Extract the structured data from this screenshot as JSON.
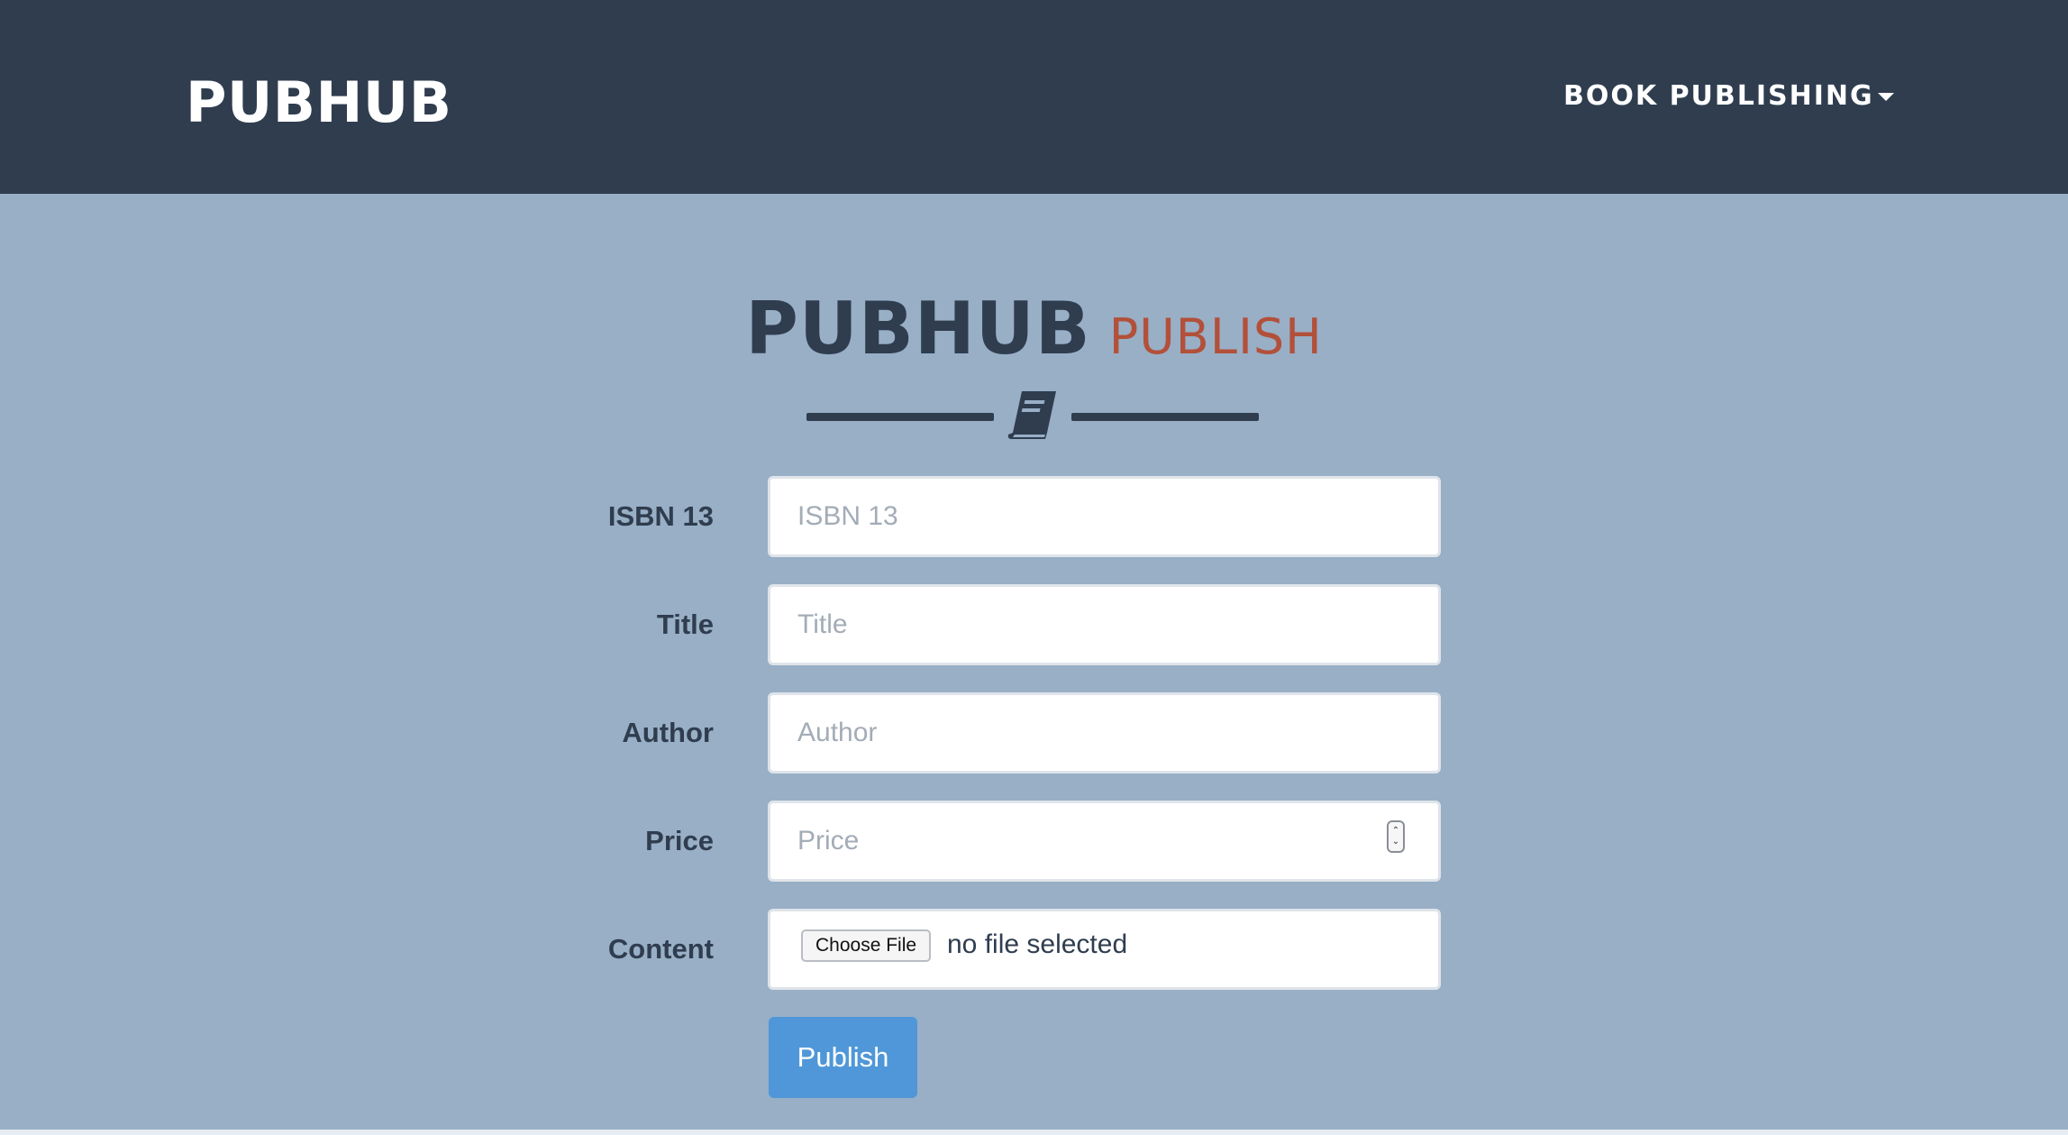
{
  "navbar": {
    "brand": "PUBHUB",
    "menu_label": "BOOK PUBLISHING"
  },
  "heading": {
    "main": "PUBHUB",
    "sub": "PUBLISH"
  },
  "form": {
    "isbn": {
      "label": "ISBN 13",
      "placeholder": "ISBN 13",
      "value": ""
    },
    "title": {
      "label": "Title",
      "placeholder": "Title",
      "value": ""
    },
    "author": {
      "label": "Author",
      "placeholder": "Author",
      "value": ""
    },
    "price": {
      "label": "Price",
      "placeholder": "Price",
      "value": ""
    },
    "content": {
      "label": "Content",
      "button_label": "Choose File",
      "status": "no file selected"
    },
    "submit_label": "Publish"
  },
  "colors": {
    "navbar_bg": "#2f3d4f",
    "page_bg": "#98afc6",
    "accent": "#b3503a",
    "button": "#4f97d8"
  },
  "icons": {
    "divider": "book-icon",
    "menu_caret": "caret-down-icon"
  }
}
